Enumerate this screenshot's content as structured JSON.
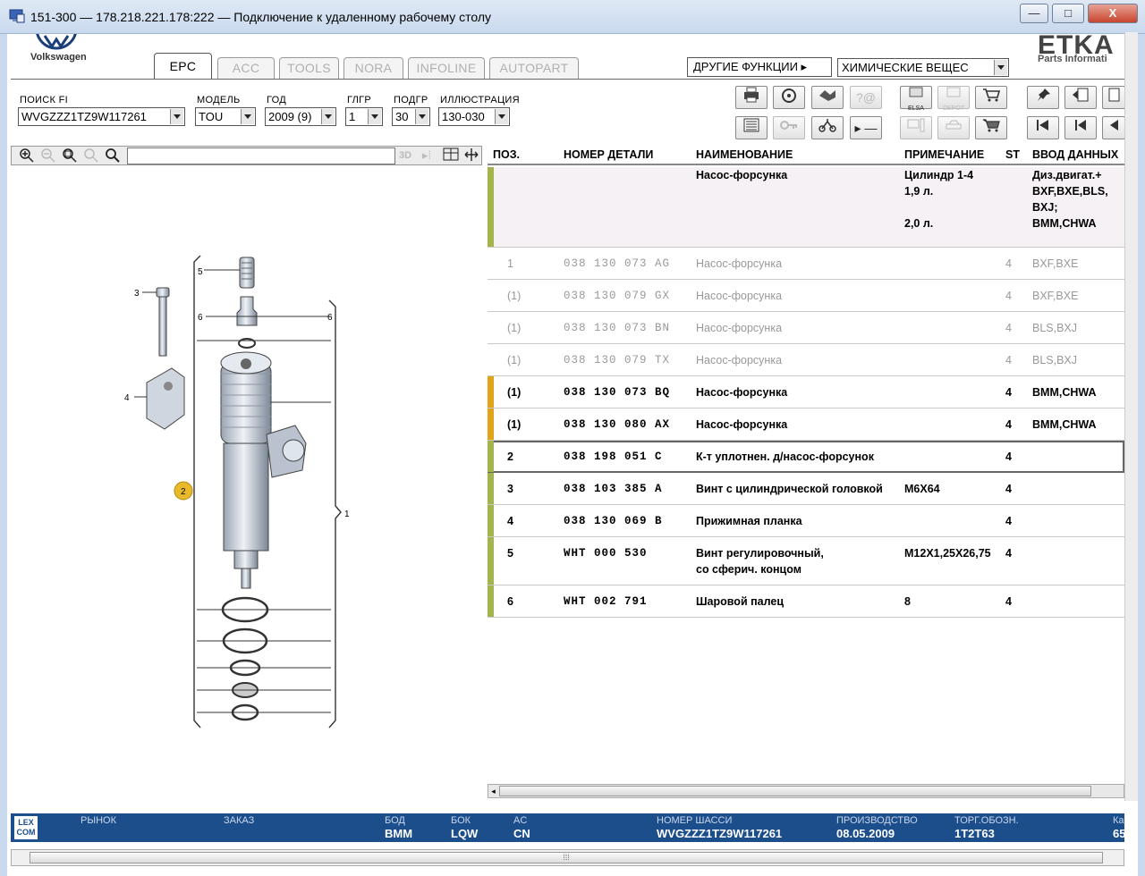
{
  "window": {
    "title": "151-300 — 178.218.221.178:222 — Подключение к удаленному рабочему столу",
    "min_label": "—",
    "max_label": "□",
    "close_label": "X"
  },
  "brand": {
    "vw": "Volkswagen",
    "etka": "ETKA",
    "etka_sub": "Parts Informati"
  },
  "tabs": [
    {
      "label": "EPC",
      "active": true
    },
    {
      "label": "ACC"
    },
    {
      "label": "TOOLS"
    },
    {
      "label": "NORA"
    },
    {
      "label": "INFOLINE"
    },
    {
      "label": "AUTOPART"
    }
  ],
  "other_functions": "ДРУГИЕ ФУНКЦИИ ▸",
  "chem_select": "ХИМИЧЕСКИЕ ВЕЩЕС",
  "filters": {
    "fi": {
      "label": "ПОИСК FI",
      "value": "WVGZZZ1TZ9W117261"
    },
    "model": {
      "label": "МОДЕЛЬ",
      "value": "TOU"
    },
    "year": {
      "label": "ГОД",
      "value": "2009 (9)"
    },
    "glgr": {
      "label": "ГЛГР",
      "value": "1"
    },
    "podgr": {
      "label": "ПОДГР",
      "value": "30"
    },
    "illus": {
      "label": "ИЛЛЮСТРАЦИЯ",
      "value": "130-030"
    }
  },
  "toolbar_icons": {
    "elsa": "ELSA",
    "depot": "DEPOT"
  },
  "table": {
    "headers": {
      "pos": "ПОЗ.",
      "part": "НОМЕР ДЕТАЛИ",
      "name": "НАИМЕНОВАНИЕ",
      "note": "ПРИМЕЧАНИЕ",
      "st": "ST",
      "input": "ВВОД ДАННЫХ"
    },
    "header_row": {
      "name": "Насос-форсунка",
      "note_lines": [
        "Цилиндр 1-4",
        "1,9 л.",
        "",
        "2,0 л."
      ],
      "input_lines": [
        "Диз.двигат.+",
        "BXF,BXE,BLS,",
        "BXJ;",
        "BMM,CHWA"
      ]
    },
    "rows": [
      {
        "pos": "1",
        "part": "038 130 073 AG",
        "name": "Насос-форсунка",
        "note": "",
        "st": "4",
        "input": "BXF,BXE",
        "state": "dim"
      },
      {
        "pos": "(1)",
        "part": "038 130 079 GX",
        "name": "Насос-форсунка",
        "note": "",
        "st": "4",
        "input": "BXF,BXE",
        "state": "dim"
      },
      {
        "pos": "(1)",
        "part": "038 130 073 BN",
        "name": "Насос-форсунка",
        "note": "",
        "st": "4",
        "input": "BLS,BXJ",
        "state": "dim"
      },
      {
        "pos": "(1)",
        "part": "038 130 079 TX",
        "name": "Насос-форсунка",
        "note": "",
        "st": "4",
        "input": "BLS,BXJ",
        "state": "dim"
      },
      {
        "pos": "(1)",
        "part": "038 130 073 BQ",
        "name": "Насос-форсунка",
        "note": "",
        "st": "4",
        "input": "BMM,CHWA",
        "state": "orange"
      },
      {
        "pos": "(1)",
        "part": "038 130 080 AX",
        "name": "Насос-форсунка",
        "note": "",
        "st": "4",
        "input": "BMM,CHWA",
        "state": "orange"
      },
      {
        "pos": "2",
        "part": "038 198 051 C",
        "name": "К-т уплотнен. д/насос-форсунок",
        "note": "",
        "st": "4",
        "input": "",
        "state": "selected"
      },
      {
        "pos": "3",
        "part": "038 103 385 A",
        "name": "Винт с цилиндрической головкой",
        "note": "M6X64",
        "st": "4",
        "input": "",
        "state": "green"
      },
      {
        "pos": "4",
        "part": "038 130 069 B",
        "name": "Прижимная планка",
        "note": "",
        "st": "4",
        "input": "",
        "state": "green"
      },
      {
        "pos": "5",
        "part": "WHT 000 530",
        "name": "Винт регулировочный,",
        "name2": "со сферич. концом",
        "note": "M12X1,25X26,75",
        "st": "4",
        "input": "",
        "state": "green"
      },
      {
        "pos": "6",
        "part": "WHT 002 791",
        "name": "Шаровой палец",
        "note": "8",
        "st": "4",
        "input": "",
        "state": "green"
      }
    ]
  },
  "illustration": {
    "callouts": [
      "5",
      "3",
      "6",
      "6",
      "4",
      "2",
      "1"
    ]
  },
  "status": {
    "lexcom": "LEX COM",
    "market": {
      "label": "РЫНОК",
      "value": ""
    },
    "order": {
      "label": "ЗАКАЗ",
      "value": ""
    },
    "bod": {
      "label": "БОД",
      "value": "BMM"
    },
    "bok": {
      "label": "БОК",
      "value": "LQW"
    },
    "ac": {
      "label": "AC",
      "value": "CN"
    },
    "chassis": {
      "label": "НОМЕР ШАССИ",
      "value": "WVGZZZ1TZ9W117261"
    },
    "production": {
      "label": "ПРОИЗВОДСТВО",
      "value": "08.05.2009"
    },
    "trade": {
      "label": "ТОРГ.ОБОЗН.",
      "value": "1T2T63"
    },
    "extra": {
      "label": "Ка",
      "value": "65"
    }
  },
  "colors": {
    "green": "#a4b44a",
    "orange": "#e2a31a",
    "status_bg": "#1d4e8c"
  }
}
